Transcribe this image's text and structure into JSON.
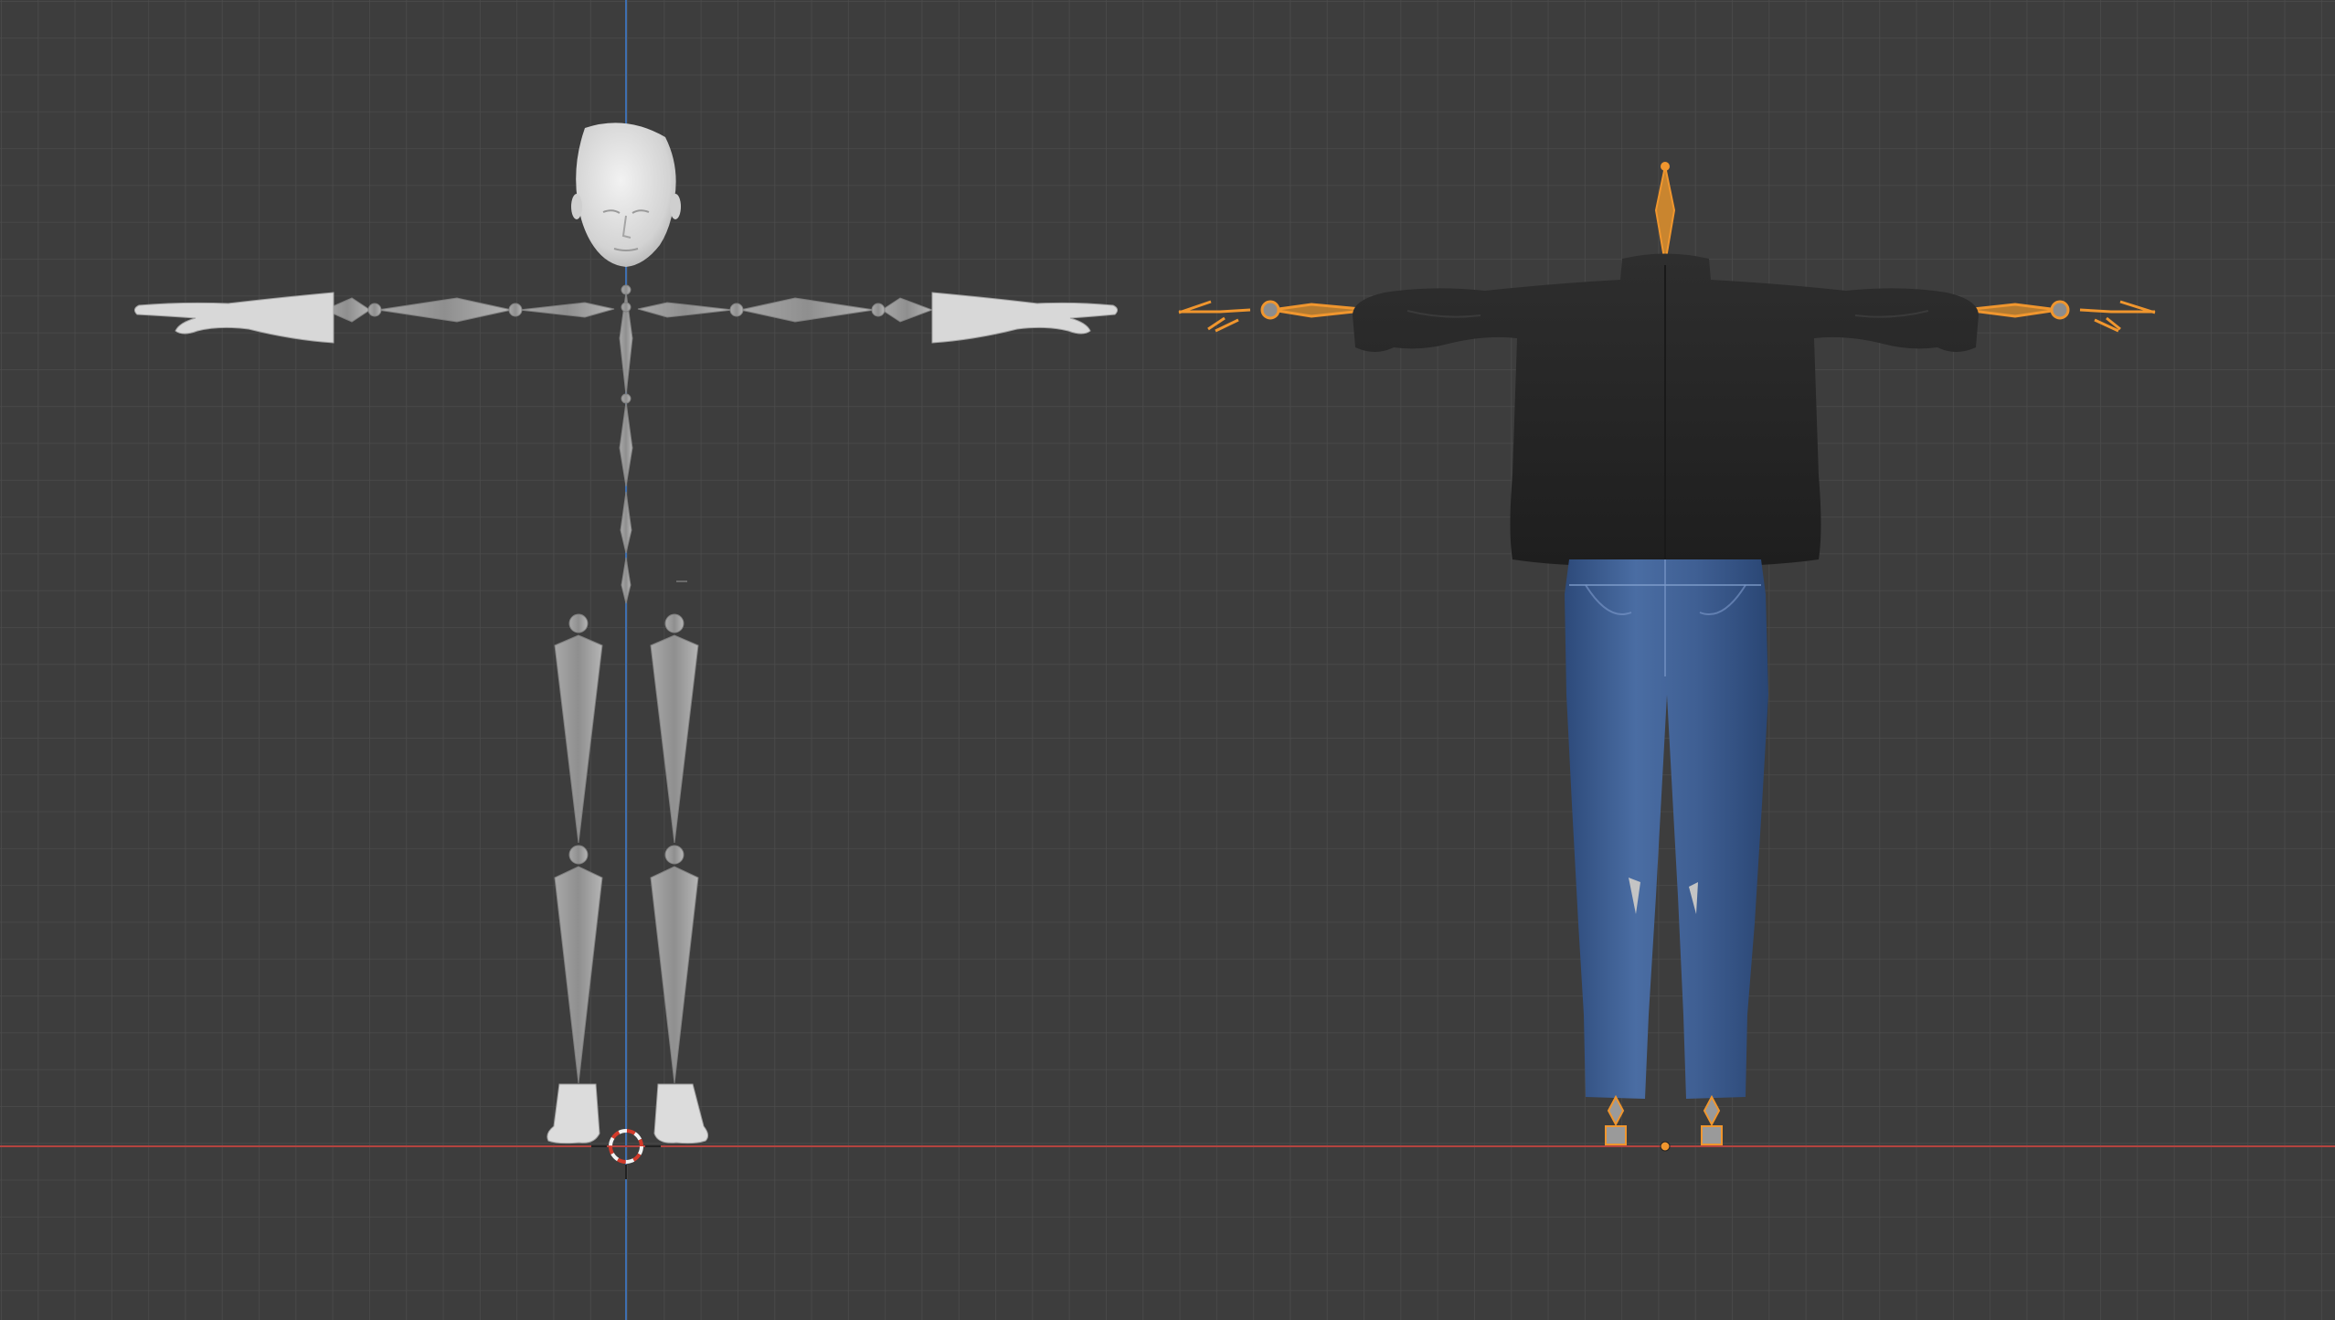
{
  "viewport": {
    "view": "front-orthographic",
    "background_color": "#3d3d3d",
    "grid_color": "#4a4a4a",
    "x_axis_color": "#b3433f",
    "z_axis_color": "#3e6fb0",
    "selection_color": "#f0962e"
  },
  "objects": [
    {
      "name": "armature-with-body-parts",
      "selected": false,
      "colors": {
        "mesh": "#d6d6d6",
        "bone": "#9c9c9c"
      }
    },
    {
      "name": "armature-with-clothing",
      "selected": true,
      "colors": {
        "shirt": "#2a2a2a",
        "jeans": "#3c5d93"
      }
    }
  ],
  "cursor_3d": {
    "name": "3d-cursor",
    "colors": {
      "ring_a": "#d23a2a",
      "ring_b": "#f2f2f2"
    }
  }
}
